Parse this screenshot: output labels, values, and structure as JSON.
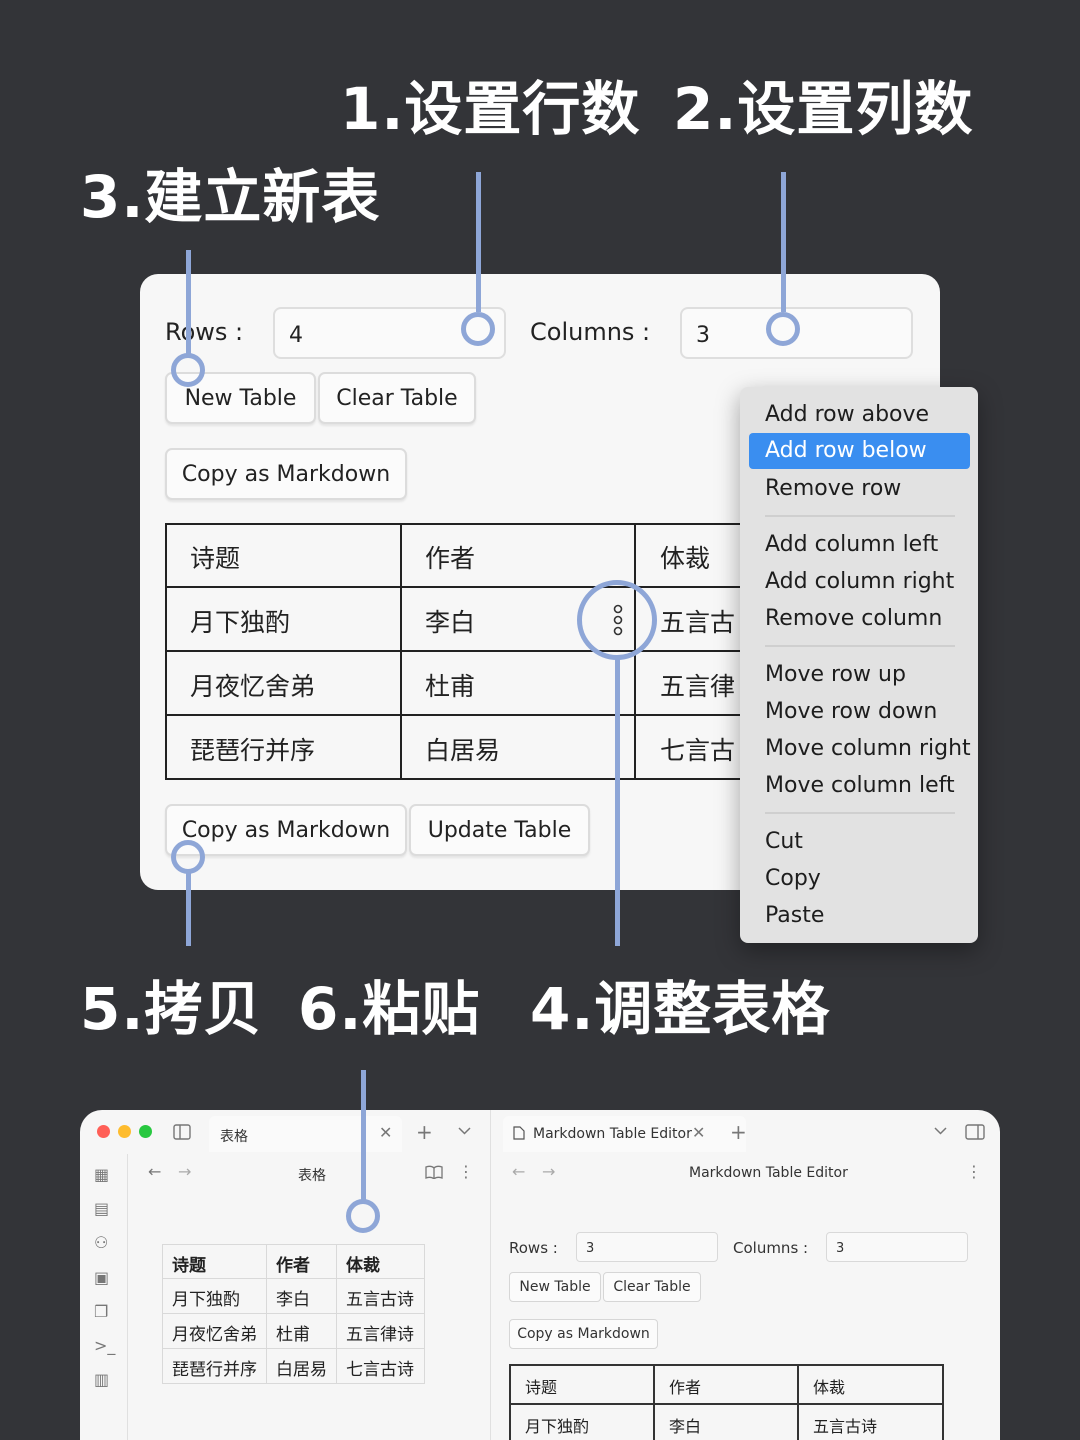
{
  "headings": {
    "step1": "1.设置行数",
    "step2": "2.设置列数",
    "step3": "3.建立新表",
    "step4": "4.调整表格",
    "step5": "5.拷贝",
    "step6": "6.粘贴"
  },
  "editor": {
    "rows_label": "Rows :",
    "rows_value": "4",
    "columns_label": "Columns :",
    "columns_value": "3",
    "new_table": "New Table",
    "clear_table": "Clear Table",
    "copy_markdown": "Copy as Markdown",
    "update_table": "Update Table",
    "row_menu_icon": "vertical-ellipsis-icon",
    "table": {
      "headers": [
        "诗题",
        "作者",
        "体裁"
      ],
      "rows": [
        [
          "月下独酌",
          "李白",
          "五言古"
        ],
        [
          "月夜忆舍弟",
          "杜甫",
          "五言律"
        ],
        [
          "琵琶行并序",
          "白居易",
          "七言古"
        ]
      ]
    }
  },
  "context_menu": {
    "items": [
      "Add row above",
      "Add row below",
      "Remove row",
      "Add column left",
      "Add column right",
      "Remove column",
      "Move row up",
      "Move row down",
      "Move column right",
      "Move column left",
      "Cut",
      "Copy",
      "Paste"
    ],
    "active": "Add row below",
    "active_color": "#3a8ef0"
  },
  "window": {
    "traffic_lights": [
      "#ff5f57",
      "#febc2e",
      "#28c840"
    ],
    "left_tab_title": "表格",
    "left_page_title": "表格",
    "right_tab_title": "Markdown Table Editor",
    "right_page_title": "Markdown Table Editor",
    "rows_label": "Rows :",
    "rows_value": "3",
    "columns_label": "Columns :",
    "columns_value": "3",
    "new_table": "New Table",
    "clear_table": "Clear Table",
    "copy_markdown": "Copy as Markdown",
    "pasted_table": {
      "headers": [
        "诗题",
        "作者",
        "体裁"
      ],
      "rows": [
        [
          "月下独酌",
          "李白",
          "五言古诗"
        ],
        [
          "月夜忆舍弟",
          "杜甫",
          "五言律诗"
        ],
        [
          "琵琶行并序",
          "白居易",
          "七言古诗"
        ]
      ]
    },
    "editor_table": {
      "headers": [
        "诗题",
        "作者",
        "体裁"
      ],
      "rows": [
        [
          "月下独酌",
          "李白",
          "五言古诗"
        ]
      ]
    },
    "sidebar_icons": [
      "grid-icon",
      "file-search-icon",
      "graph-icon",
      "calendar-icon",
      "copy-icon",
      "terminal-icon",
      "table-icon"
    ]
  },
  "colors": {
    "background": "#333438",
    "callout": "#8ea6d7",
    "panel": "#f7f7f7"
  }
}
